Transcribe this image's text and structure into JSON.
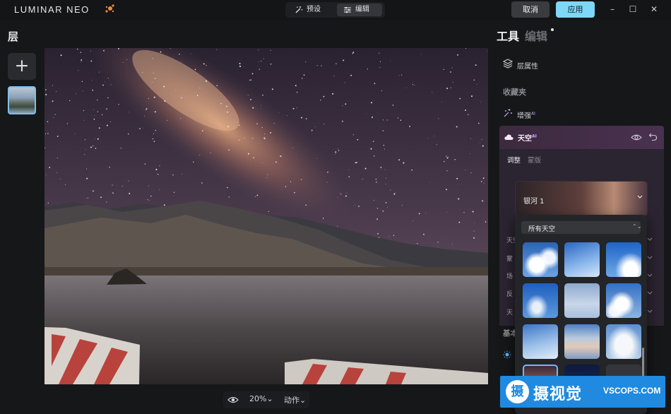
{
  "app": {
    "logo": "LUMINAR NEO"
  },
  "topbar": {
    "mode_preset": "预设",
    "mode_edit": "编辑",
    "cancel": "取消",
    "apply": "应用",
    "minimize": "–",
    "maximize": "☐",
    "close": "✕"
  },
  "left": {
    "title": "层",
    "add_label": "+"
  },
  "bottombar": {
    "zoom": "20%⌄",
    "actions": "动作⌄"
  },
  "right": {
    "tab_tools": "工具",
    "tab_edit": "编辑",
    "layer_props": "层属性",
    "favorites": "收藏夹",
    "enhance": "增强",
    "enhance_sup": "AI",
    "sky": "天空",
    "sky_sup": "AI",
    "subtab_adjust": "调整",
    "subtab_mask": "蒙版",
    "sky_selected": "银河 1",
    "ghost_rows": [
      "天空",
      "蒙",
      "场",
      "反",
      "天"
    ],
    "basic": "基本"
  },
  "dropdown": {
    "filter": "所有天空",
    "arrows": "⌃⌄"
  },
  "watermark": {
    "circle": "摄",
    "cn": "摄视觉",
    "en": "VSCOPS.COM"
  },
  "colors": {
    "accent": "#7fd7f6",
    "sky_panel": "#2b2431",
    "selection": "#6fb9ff",
    "watermark": "#1f8ae0"
  }
}
